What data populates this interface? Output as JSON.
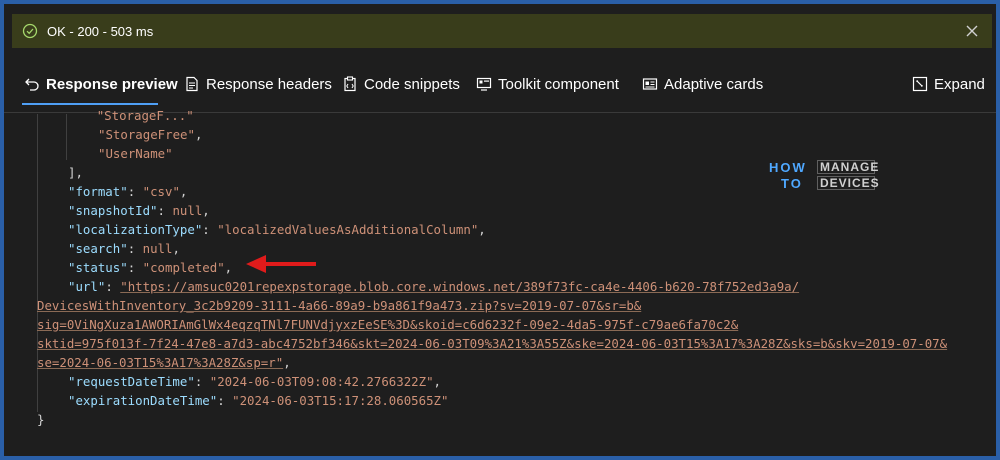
{
  "status": {
    "text": "OK - 200 - 503 ms",
    "color": "#393d1b"
  },
  "tabs": [
    {
      "label": "Response preview",
      "icon": "undo-arrow-icon",
      "active": true
    },
    {
      "label": "Response headers",
      "icon": "document-icon"
    },
    {
      "label": "Code snippets",
      "icon": "clipboard-icon"
    },
    {
      "label": "Toolkit component",
      "icon": "toolkit-icon"
    },
    {
      "label": "Adaptive cards",
      "icon": "card-icon"
    },
    {
      "label": "Expand",
      "icon": "expand-icon"
    }
  ],
  "code": {
    "line1": "\"StorageFree\"",
    "line2": "\"UserName\"",
    "format_key": "\"format\"",
    "format_val": "\"csv\"",
    "snapshot_key": "\"snapshotId\"",
    "snapshot_val": "null",
    "loc_key": "\"localizationType\"",
    "loc_val": "\"localizedValuesAsAdditionalColumn\"",
    "search_key": "\"search\"",
    "search_val": "null",
    "status_key": "\"status\"",
    "status_val": "\"completed\"",
    "url_key": "\"url\"",
    "url_1": "\"https://amsuc0201repexpstorage.blob.core.windows.net/389f73fc-ca4e-4406-b620-78f752ed3a9a/",
    "url_2": "DevicesWithInventory_3c2b9209-3111-4a66-89a9-b9a861f9a473.zip?sv=2019-07-07&sr=b&",
    "url_3": "sig=0ViNgXuza1AWORIAmGlWx4eqzqTNl7FUNVdjyxzEeSE%3D&skoid=c6d6232f-09e2-4da5-975f-c79ae6fa70c2&",
    "url_4": "sktid=975f013f-7f24-47e8-a7d3-abc4752bf346&skt=2024-06-03T09%3A21%3A55Z&ske=2024-06-03T15%3A17%3A28Z&sks=b&skv=2019-07-07&",
    "url_5": "se=2024-06-03T15%3A17%3A28Z&sp=r\"",
    "req_key": "\"requestDateTime\"",
    "req_val": "\"2024-06-03T09:08:42.2766322Z\"",
    "exp_key": "\"expirationDateTime\"",
    "exp_val": "\"2024-06-03T15:17:28.060565Z\""
  },
  "watermark": {
    "how": "HOW",
    "to": "TO",
    "manage": "MANAGE",
    "devices": "DEVICES"
  }
}
